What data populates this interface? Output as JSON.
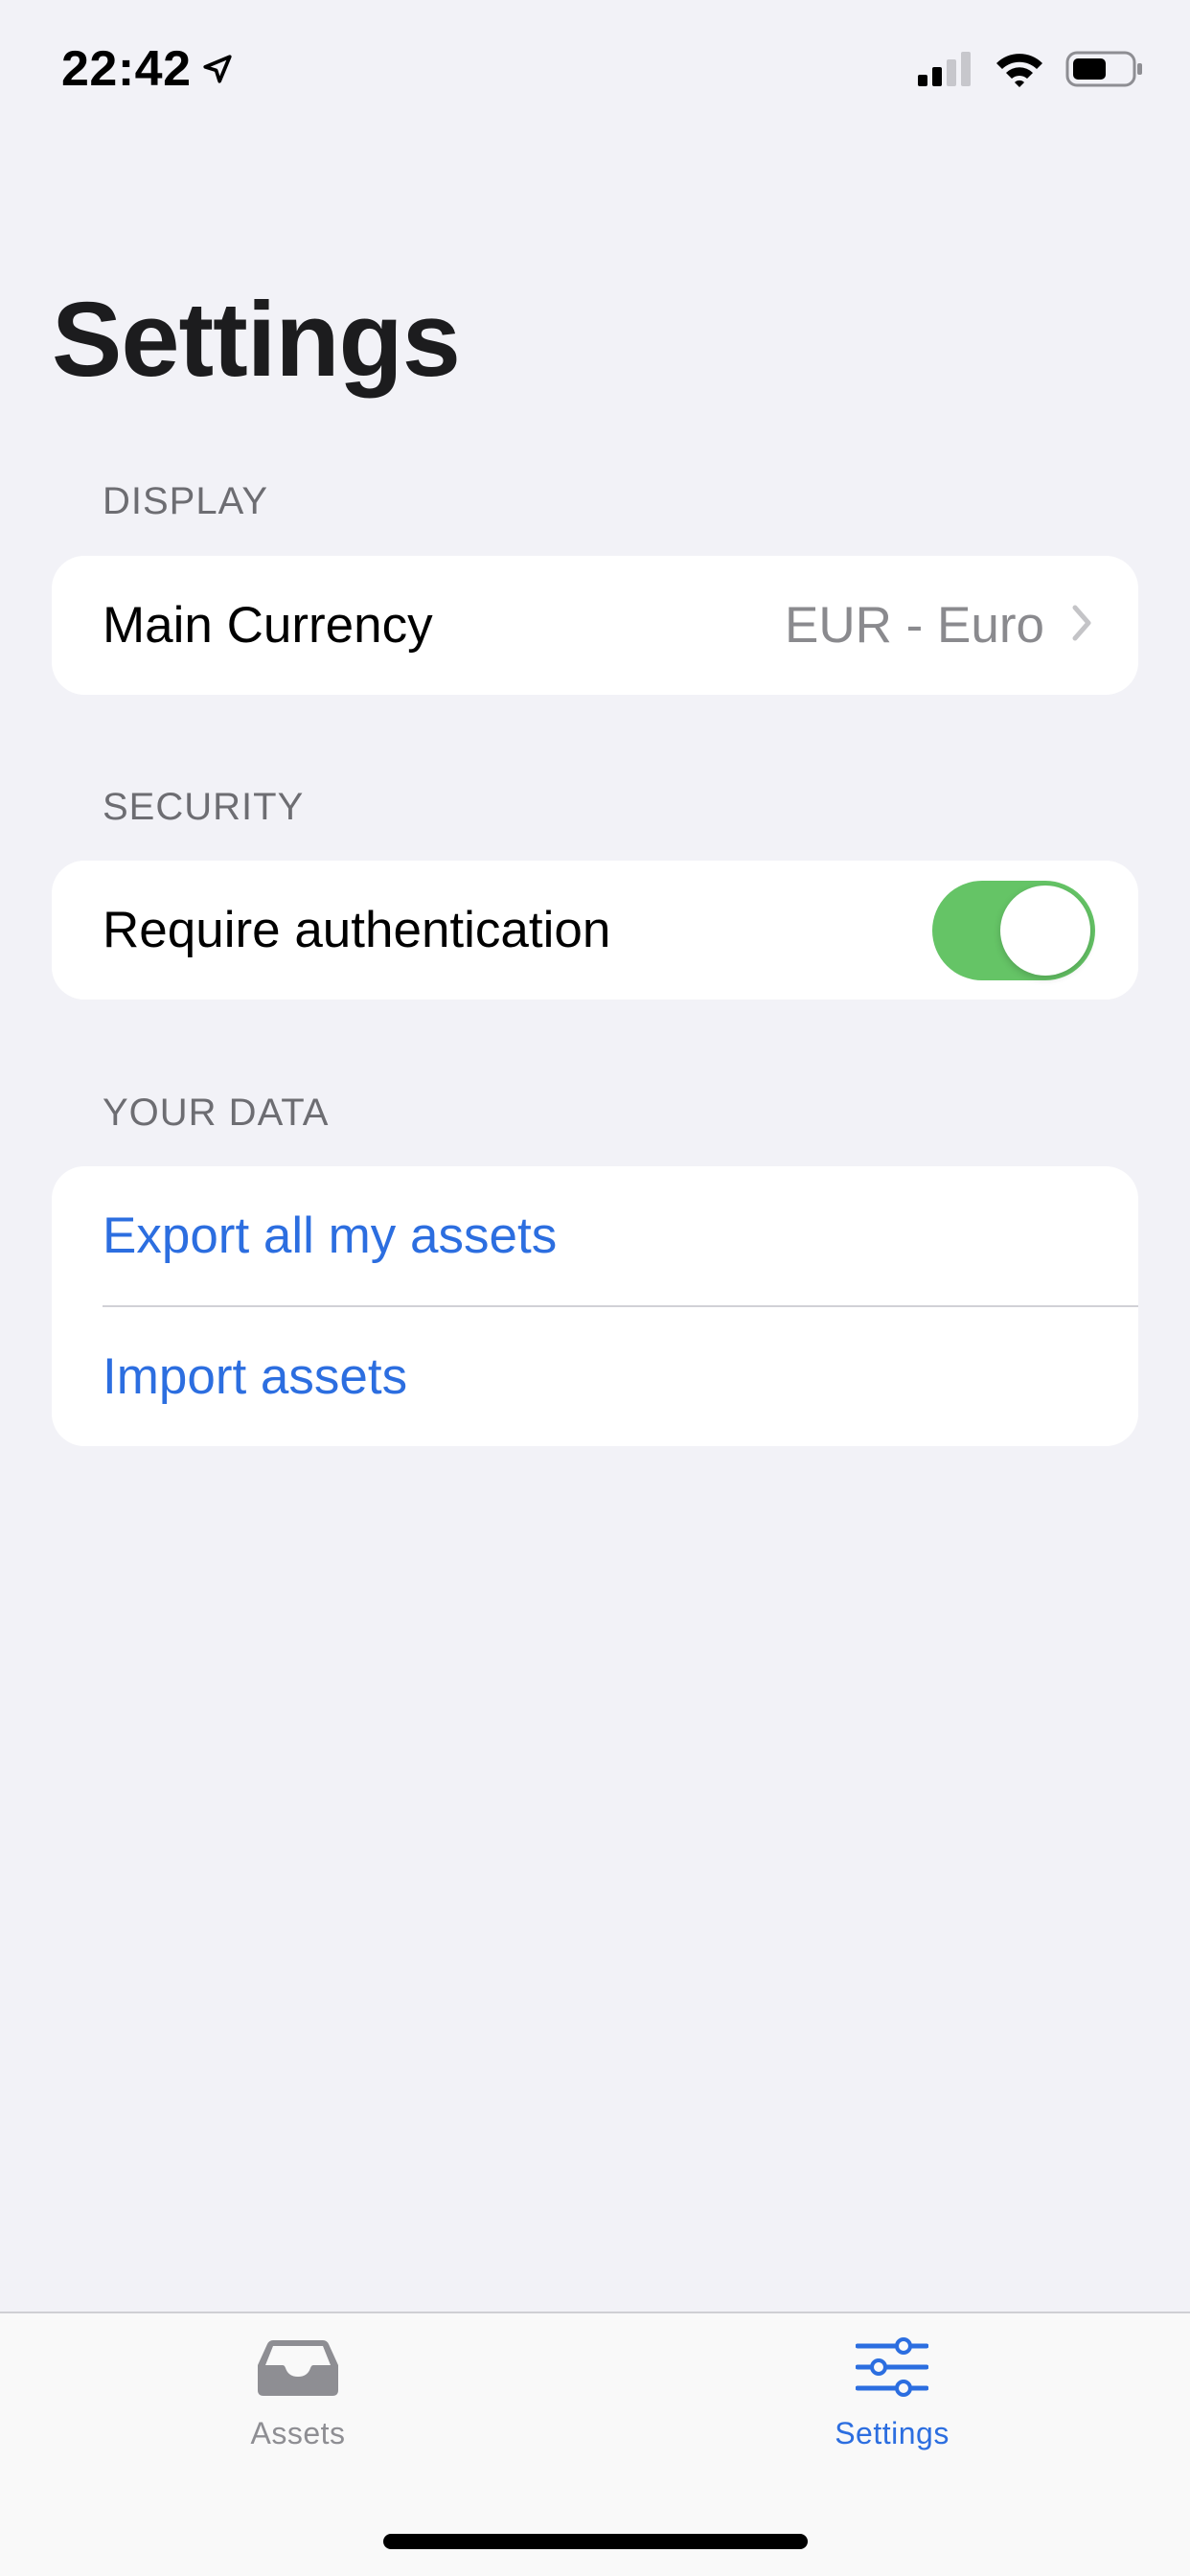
{
  "status_bar": {
    "time": "22:42",
    "icons": [
      "location-arrow-icon",
      "cellular-signal-icon",
      "wifi-icon",
      "battery-icon"
    ]
  },
  "page": {
    "title": "Settings"
  },
  "sections": {
    "display": {
      "header": "DISPLAY",
      "main_currency_label": "Main Currency",
      "main_currency_value": "EUR - Euro"
    },
    "security": {
      "header": "SECURITY",
      "require_auth_label": "Require authentication",
      "require_auth_enabled": true
    },
    "your_data": {
      "header": "YOUR DATA",
      "export_label": "Export all my assets",
      "import_label": "Import assets"
    }
  },
  "tab_bar": {
    "tabs": [
      {
        "label": "Assets",
        "icon": "tray-icon",
        "selected": false
      },
      {
        "label": "Settings",
        "icon": "sliders-icon",
        "selected": true
      }
    ]
  },
  "colors": {
    "accent": "#2c6ee0",
    "toggle_on": "#65c466",
    "background": "#f2f2f7",
    "secondary_text": "#6d6d72"
  }
}
